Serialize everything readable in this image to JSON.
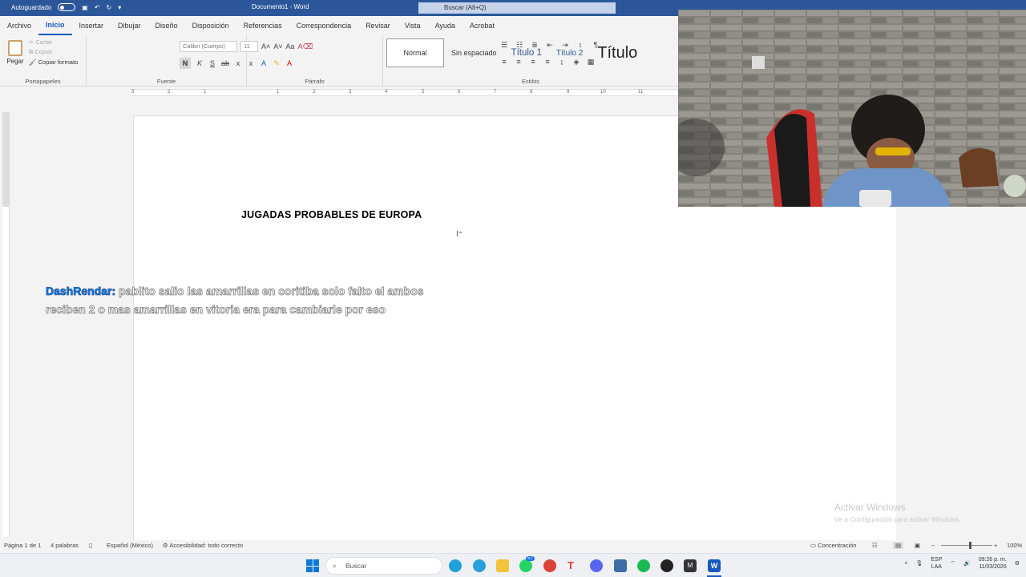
{
  "titlebar": {
    "autosave": "Autoguardado",
    "document_title": "Documento1 - Word",
    "search_placeholder": "Buscar (Alt+Q)"
  },
  "menu": {
    "items": [
      "Archivo",
      "Inicio",
      "Insertar",
      "Dibujar",
      "Diseño",
      "Disposición",
      "Referencias",
      "Correspondencia",
      "Revisar",
      "Vista",
      "Ayuda",
      "Acrobat"
    ],
    "active": "Inicio"
  },
  "ribbon": {
    "clipboard": {
      "paste": "Pegar",
      "cut": "Cortar",
      "copy": "Copiar",
      "format_painter": "Copiar formato",
      "label": "Portapapeles"
    },
    "font": {
      "font_name": "Calibri (Cuerpo)",
      "font_size": "11",
      "bold": "N",
      "italic": "K",
      "underline": "S",
      "strike": "ab",
      "subscript": "x",
      "superscript": "x",
      "label": "Fuente"
    },
    "paragraph": {
      "label": "Párrafo"
    },
    "styles": {
      "items": [
        "Normal",
        "Sin espaciado",
        "Título 1",
        "Título 2",
        "Título"
      ],
      "selected": "Normal",
      "label": "Estilos"
    }
  },
  "ruler": {
    "numbers": [
      "3",
      "2",
      "1",
      "1",
      "2",
      "3",
      "4",
      "5",
      "6",
      "7",
      "8",
      "9",
      "10",
      "11"
    ]
  },
  "document": {
    "heading": "JUGADAS PROBABLES DE EUROPA"
  },
  "chat": {
    "user": "DashRendar:",
    "message": " pablito salio las amarrillas en coritiba solo falto el ambos reciben 2 o mas amarrillas en vitoria era para cambiarle por eso"
  },
  "watermark": {
    "title": "Activar Windows",
    "subtitle": "Ve a Configuración para activar Windows."
  },
  "statusbar": {
    "page": "Página 1 de 1",
    "words": "4 palabras",
    "language": "Español (México)",
    "accessibility": "Accesibilidad: todo correcto",
    "focus": "Concentración",
    "zoom": "100%"
  },
  "taskbar": {
    "search_placeholder": "Buscar",
    "whatsapp_badge": "57",
    "lang_line1": "ESP",
    "lang_line2": "LAA",
    "time": "09:26 p. m.",
    "date": "11/03/2026"
  },
  "colors": {
    "word_blue": "#2b579a",
    "accent": "#185abd",
    "chat_user": "#1e88e5"
  }
}
